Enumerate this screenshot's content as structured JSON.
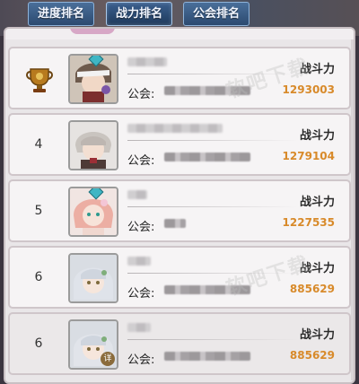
{
  "tabs": [
    {
      "label": "进度排名",
      "active": false
    },
    {
      "label": "战力排名",
      "active": true
    },
    {
      "label": "公会排名",
      "active": false
    }
  ],
  "rows": [
    {
      "rank": "",
      "rank_icon": "trophy-icon",
      "guild_label": "公会:",
      "power_label": "战斗力",
      "power": "1293003",
      "detail_badge": ""
    },
    {
      "rank": "4",
      "guild_label": "公会:",
      "power_label": "战斗力",
      "power": "1279104",
      "detail_badge": ""
    },
    {
      "rank": "5",
      "guild_label": "公会:",
      "power_label": "战斗力",
      "power": "1227535",
      "detail_badge": ""
    },
    {
      "rank": "6",
      "guild_label": "公会:",
      "power_label": "战斗力",
      "power": "885629",
      "detail_badge": ""
    },
    {
      "rank": "6",
      "guild_label": "公会:",
      "power_label": "战斗力",
      "power": "885629",
      "detail_badge": "详"
    }
  ],
  "watermark": "软吧下载",
  "colors": {
    "power_value": "#d88a2a",
    "tab_bg": "#2c4a70",
    "panel_bg": "#e9e6e8"
  }
}
